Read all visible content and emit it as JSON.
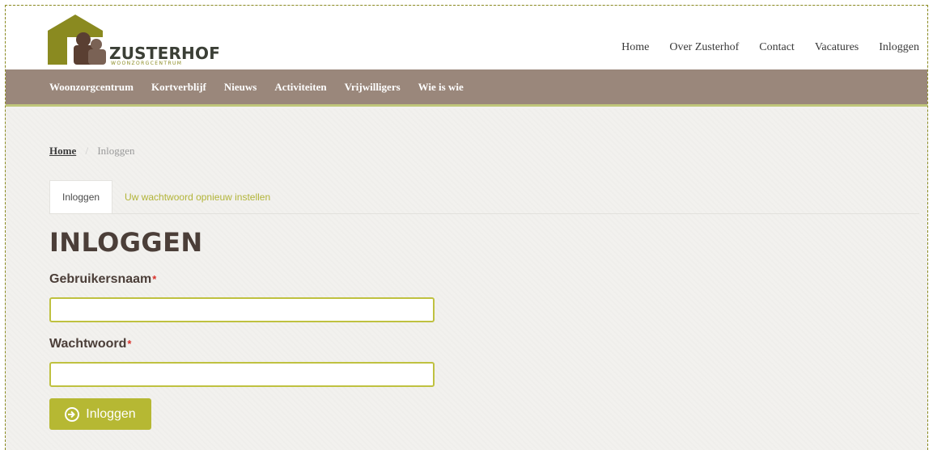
{
  "brand": {
    "name": "ZUSTERHOF",
    "subtitle": "WOONZORGCENTRUM",
    "colors": {
      "olive": "#8a8a20",
      "brown": "#9a877b",
      "dark": "#4b3e38",
      "accent": "#b6b833"
    }
  },
  "top_nav": {
    "items": [
      {
        "label": "Home"
      },
      {
        "label": "Over Zusterhof"
      },
      {
        "label": "Contact"
      },
      {
        "label": "Vacatures"
      },
      {
        "label": "Inloggen"
      }
    ]
  },
  "main_nav": {
    "items": [
      {
        "label": "Woonzorgcentrum"
      },
      {
        "label": "Kortverblijf"
      },
      {
        "label": "Nieuws"
      },
      {
        "label": "Activiteiten"
      },
      {
        "label": "Vrijwilligers"
      },
      {
        "label": "Wie is wie"
      }
    ]
  },
  "breadcrumb": {
    "home": "Home",
    "separator": "/",
    "current": "Inloggen"
  },
  "tabs": [
    {
      "label": "Inloggen",
      "active": true
    },
    {
      "label": "Uw wachtwoord opnieuw instellen",
      "active": false
    }
  ],
  "form": {
    "title": "INLOGGEN",
    "username_label": "Gebruikersnaam",
    "username_value": "",
    "password_label": "Wachtwoord",
    "password_value": "",
    "required_marker": "*",
    "submit_label": "Inloggen",
    "submit_icon": "sign-in-icon"
  }
}
